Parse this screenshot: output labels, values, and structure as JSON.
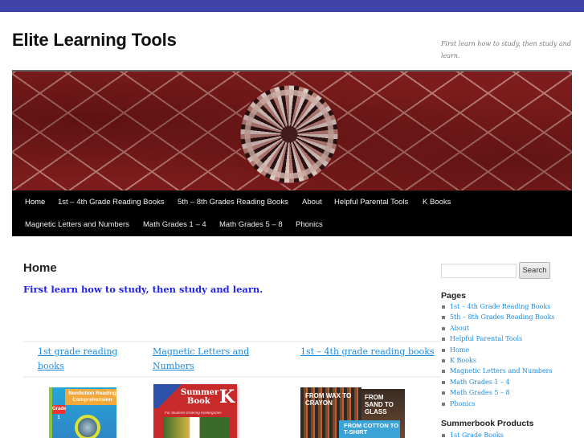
{
  "site": {
    "title": "Elite Learning Tools",
    "description": "First learn how to study, then study and learn.",
    "accent_color": "#3f42a6"
  },
  "nav": {
    "items": [
      {
        "label": "Home",
        "current": true
      },
      {
        "label": "1st – 4th Grade Reading Books"
      },
      {
        "label": "5th – 8th Grades Reading Books"
      },
      {
        "label": "About"
      },
      {
        "label": "Helpful Parental Tools"
      },
      {
        "label": "K Books"
      },
      {
        "label": "Magnetic Letters and Numbers"
      },
      {
        "label": "Math Grades 1 – 4"
      },
      {
        "label": "Math Grades 5 – 8"
      },
      {
        "label": "Phonics"
      }
    ]
  },
  "main": {
    "title": "Home",
    "intro": "First learn how to study, then study and learn.",
    "grid": [
      {
        "link_line1": "1st grade reading",
        "link_line2": "books",
        "image": "nonfiction-reading-comprehension-book"
      },
      {
        "link_line1": "Magnetic Letters and",
        "link_line2": "Numbers",
        "image": "summer-book-k"
      },
      {
        "link_line1": "1st – 4th grade reading books",
        "link_line2": "",
        "image": "from-wax-to-crayon-books"
      }
    ],
    "book_covers": {
      "nonfiction": {
        "tab": "Nonfiction Reading Comprehension",
        "grade": "Grade 1"
      },
      "summer": {
        "line1": "Summer",
        "line2": "Book",
        "letter": "K",
        "sub": "For Students Entering Kindergarten"
      },
      "wax": "FROM WAX TO CRAYON",
      "sand": "FROM SAND TO GLASS",
      "cotton": "FROM COTTON TO T-SHIRT"
    }
  },
  "sidebar": {
    "search": {
      "placeholder": "",
      "value": "",
      "button_label": "Search"
    },
    "pages_title": "Pages",
    "pages": [
      "1st – 4th Grade Reading Books",
      "5th – 8th Grades Reading Books",
      "About",
      "Helpful Parental Tools",
      "Home",
      "K Books",
      "Magnetic Letters and Numbers",
      "Math Grades 1 – 4",
      "Math Grades 5 – 8",
      "Phonics"
    ],
    "summer_title": "Summerbook Products",
    "summer_items": [
      "1st Grade Books"
    ]
  }
}
